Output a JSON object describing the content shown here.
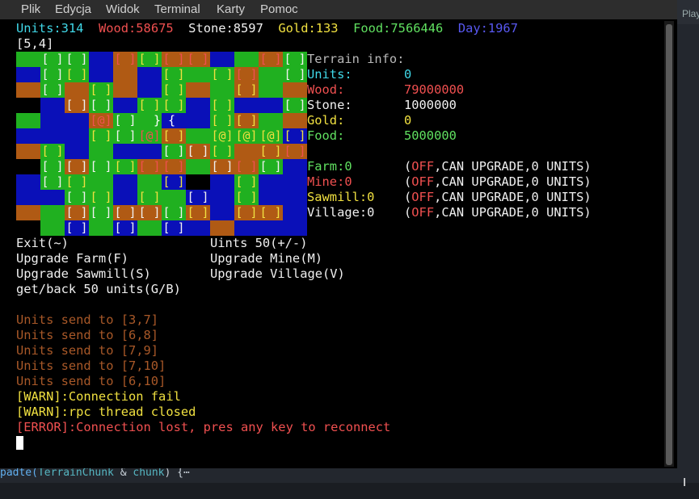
{
  "menu": [
    "Plik",
    "Edycja",
    "Widok",
    "Terminal",
    "Karty",
    "Pomoc"
  ],
  "status": {
    "units": "Units:314",
    "wood": "Wood:58675",
    "stone": "Stone:8597",
    "gold": "Gold:133",
    "food": "Food:7566446",
    "day": "Day:1967"
  },
  "coord": "[5,4]",
  "terrain_info": {
    "title": "Terrain info:",
    "rows": [
      {
        "label": "Units:",
        "value": "0",
        "label_color": "#40d8e8",
        "value_color": "#40d8e8"
      },
      {
        "label": "Wood:",
        "value": "79000000",
        "label_color": "#f05050",
        "value_color": "#f05050"
      },
      {
        "label": "Stone:",
        "value": "1000000",
        "label_color": "#f0f0f0",
        "value_color": "#f0f0f0"
      },
      {
        "label": "Gold:",
        "value": "0",
        "label_color": "#f0e040",
        "value_color": "#f0e040"
      },
      {
        "label": "Food:",
        "value": "5000000",
        "label_color": "#60e060",
        "value_color": "#60e060"
      }
    ]
  },
  "buildings": [
    {
      "label": "Farm:0",
      "color": "#60e060"
    },
    {
      "label": "Mine:0",
      "color": "#f05050"
    },
    {
      "label": "Sawmill:0",
      "color": "#f0e040"
    },
    {
      "label": "Village:0",
      "color": "#f0f0f0"
    }
  ],
  "building_status": {
    "open": "(",
    "off": "OFF",
    "rest": ",CAN UPGRADE,0 UNITS)"
  },
  "commands": [
    {
      "left": "Exit(~)",
      "right": "Uints 50(+/-)"
    },
    {
      "left": "Upgrade Farm(F)",
      "right": "Upgrade Mine(M)"
    },
    {
      "left": "Upgrade Sawmill(S)",
      "right": "Upgrade Village(V)"
    },
    {
      "left": "get/back 50 units(G/B)",
      "right": ""
    }
  ],
  "log": [
    {
      "text": "Units send to [3,7]",
      "type": "faded"
    },
    {
      "text": "Units send to [6,8]",
      "type": "faded"
    },
    {
      "text": "Units send to [7,9]",
      "type": "faded"
    },
    {
      "text": "Units send to [7,10]",
      "type": "faded"
    },
    {
      "text": "Units send to [6,10]",
      "type": "faded"
    },
    {
      "text": "[WARN]:Connection fail",
      "type": "warn"
    },
    {
      "text": "[WARN]:rpc thread closed",
      "type": "warn"
    },
    {
      "text": "[ERROR]:Connection lost, pres any key to reconnect",
      "type": "error"
    }
  ],
  "map_cursor": "} {",
  "background": {
    "bottom_code_prefix": "padte(",
    "bottom_code_type": "TerrainChunk",
    "bottom_code_amp": " & ",
    "bottom_code_arg": "chunk",
    "bottom_code_end": ") {⋯",
    "right_tab": "Play"
  },
  "colors": {
    "grass": "#20b020",
    "water": "#0a10b8",
    "dirt": "#b05a14",
    "void": "#000000"
  }
}
